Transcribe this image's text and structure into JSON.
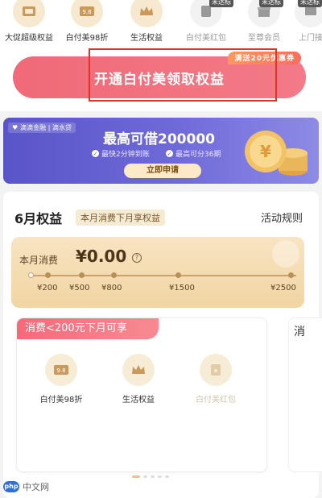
{
  "top": {
    "icons": [
      {
        "label": "大促超级权益",
        "icon": "coupon-icon",
        "tag": ""
      },
      {
        "label": "白付美98折",
        "icon": "discount-9.8-icon",
        "tag": ""
      },
      {
        "label": "生活权益",
        "icon": "crown-icon",
        "tag": ""
      },
      {
        "label": "白付美红包",
        "icon": "red-packet-icon",
        "tag": "未达标"
      },
      {
        "label": "至尊会员",
        "icon": "vip-gift-icon",
        "tag": "未达标"
      },
      {
        "label": "上门接",
        "icon": "delivery-icon",
        "tag": "未达标"
      }
    ],
    "open_button": "开通白付美领取权益",
    "open_button_tag": "满送20元优惠券"
  },
  "loan": {
    "brand": "滴滴金融 | 滴水贷",
    "title": "最高可借200000",
    "point1": "最快2分钟到账",
    "point2": "最高可分36期",
    "button": "立即申请"
  },
  "month": {
    "title": "6月权益",
    "tag": "本月消费下月享权益",
    "rules": "活动规则",
    "spend_label": "本月消费",
    "spend_amount": "¥0.00",
    "help": "?",
    "ticks": [
      "¥200",
      "¥500",
      "¥800",
      "¥1500",
      "¥2500"
    ],
    "tier": {
      "banner": "消费<200元下月可享",
      "items": [
        {
          "label": "白付美98折",
          "icon": "discount-9.8-icon"
        },
        {
          "label": "生活权益",
          "icon": "crown-icon"
        },
        {
          "label": "白付美红包",
          "icon": "red-packet-icon"
        }
      ]
    },
    "next_tier_banner": "消"
  },
  "watermark": {
    "logo": "php",
    "text": "中文网"
  },
  "colors": {
    "accent_pink": "#f06a78",
    "gold": "#f1d5a3",
    "purple": "#5a54c9"
  }
}
